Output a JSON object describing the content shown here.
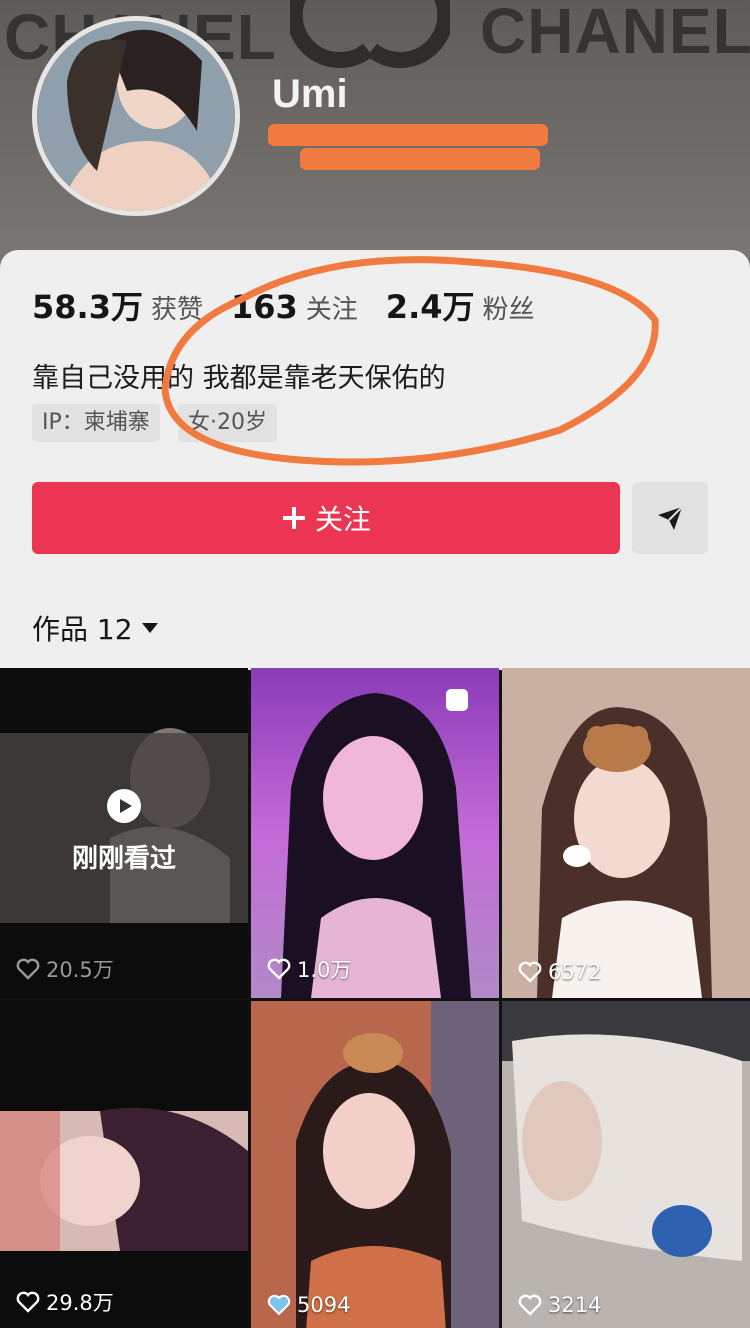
{
  "profile": {
    "brand_left": "CHANEL",
    "brand_right": "CHANEL",
    "username": "Umi"
  },
  "stats": [
    {
      "value": "58.3万",
      "label": "获赞"
    },
    {
      "value": "163",
      "label": "关注"
    },
    {
      "value": "2.4万",
      "label": "粉丝"
    }
  ],
  "bio": "靠自己没用的 我都是靠老天保佑的",
  "tags": {
    "ip": "IP：柬埔寨",
    "gender_age": "女·20岁"
  },
  "actions": {
    "follow_label": "关注",
    "follow_icon": "plus-icon",
    "send_icon": "send-icon"
  },
  "works": {
    "label": "作品 12"
  },
  "videos": [
    {
      "likes": "20.5万",
      "watched_label": "刚刚看过"
    },
    {
      "likes": "1.0万"
    },
    {
      "likes": "6572"
    },
    {
      "likes": "29.8万"
    },
    {
      "likes": "5094"
    },
    {
      "likes": "3214"
    }
  ],
  "colors": {
    "accent": "#ec3453",
    "annotation": "#f07a3f"
  }
}
